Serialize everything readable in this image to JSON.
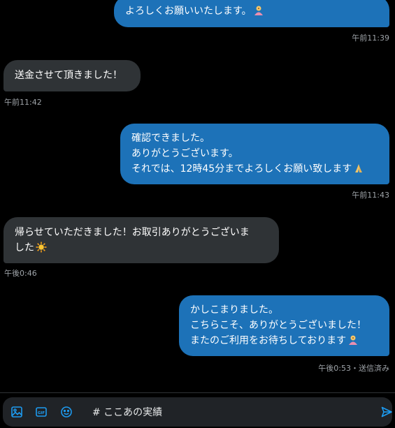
{
  "messages": [
    {
      "direction": "outgoing",
      "lines": [
        "よろしくお願いいたします。"
      ],
      "emoji": "person-bowing-icon",
      "time": "午前11:39"
    },
    {
      "direction": "incoming",
      "lines": [
        "送金させて頂きました！"
      ],
      "time": "午前11:42"
    },
    {
      "direction": "outgoing",
      "lines": [
        "確認できました。",
        "ありがとうございます。",
        "それでは、12時45分までよろしくお願い致します"
      ],
      "emoji": "folded-hands-icon",
      "time": "午前11:43"
    },
    {
      "direction": "incoming",
      "lines": [
        "帰らせていただきました！お取引ありがとうございま",
        "した"
      ],
      "emoji": "sun-icon",
      "time": "午後0:46"
    },
    {
      "direction": "outgoing",
      "lines": [
        "かしこまりました。",
        "こちらこそ、ありがとうございました！",
        "またのご利用をお待ちしております"
      ],
      "emoji": "person-bowing-icon",
      "time": "午後0:53・送信済み"
    }
  ],
  "composer": {
    "value": "# ここあの実績",
    "icons": [
      "image-icon",
      "gif-icon",
      "emoji-icon",
      "send-icon"
    ]
  },
  "colors": {
    "background": "#000000",
    "outgoing_bubble": "#1d72b8",
    "incoming_bubble": "#2f3336",
    "accent": "#1d9bf0",
    "meta_text": "#9ea3a8"
  }
}
